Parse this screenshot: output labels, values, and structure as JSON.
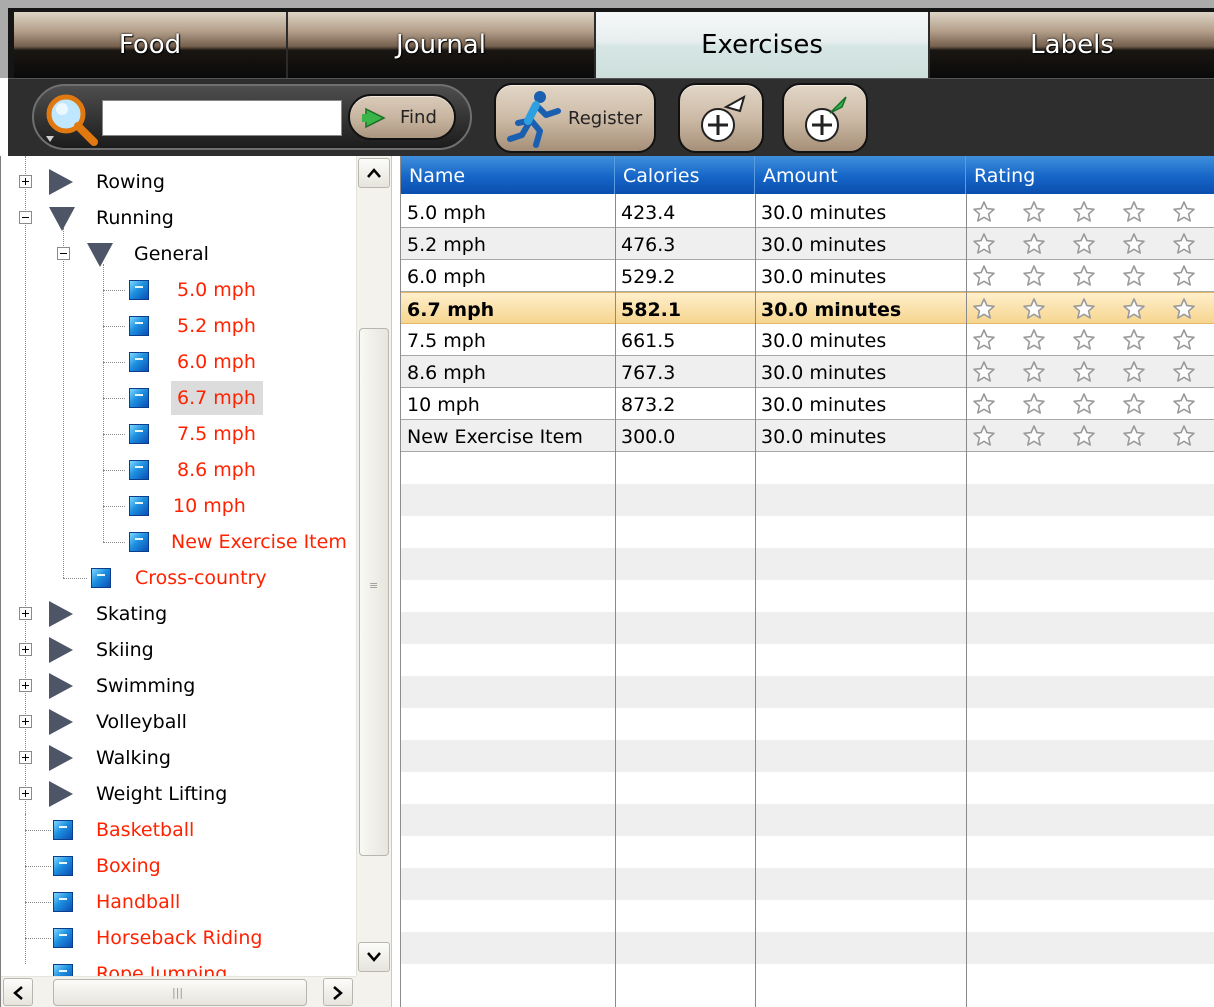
{
  "tabs": [
    {
      "label": "Food",
      "active": false
    },
    {
      "label": "Journal",
      "active": false
    },
    {
      "label": "Exercises",
      "active": true
    },
    {
      "label": "Labels",
      "active": false
    }
  ],
  "toolbar": {
    "search_value": "",
    "find_label": "Find",
    "register_label": "Register"
  },
  "tree": {
    "top_groups": [
      "Rowing",
      "Running"
    ],
    "running_subgroup": "General",
    "general_items": [
      "5.0 mph",
      "5.2 mph",
      "6.0 mph",
      "6.7 mph",
      "7.5 mph",
      "8.6 mph",
      "10 mph",
      "New Exercise Item"
    ],
    "selected_item": "6.7 mph",
    "running_leaf": "Cross-country",
    "more_groups": [
      "Skating",
      "Skiing",
      "Swimming",
      "Volleyball",
      "Walking",
      "Weight Lifting"
    ],
    "root_leaves": [
      "Basketball",
      "Boxing",
      "Handball",
      "Horseback Riding"
    ],
    "partial_leaf": "Rope Jumping"
  },
  "grid": {
    "columns": [
      "Name",
      "Calories",
      "Amount",
      "Rating"
    ],
    "rows": [
      {
        "name": "5.0 mph",
        "calories": "423.4",
        "amount": "30.0 minutes",
        "rating": 0
      },
      {
        "name": "5.2 mph",
        "calories": "476.3",
        "amount": "30.0 minutes",
        "rating": 0
      },
      {
        "name": "6.0 mph",
        "calories": "529.2",
        "amount": "30.0 minutes",
        "rating": 0
      },
      {
        "name": "6.7 mph",
        "calories": "582.1",
        "amount": "30.0 minutes",
        "rating": 0,
        "selected": true
      },
      {
        "name": "7.5 mph",
        "calories": "661.5",
        "amount": "30.0 minutes",
        "rating": 0
      },
      {
        "name": "8.6 mph",
        "calories": "767.3",
        "amount": "30.0 minutes",
        "rating": 0
      },
      {
        "name": "10 mph",
        "calories": "873.2",
        "amount": "30.0 minutes",
        "rating": 0
      },
      {
        "name": "New Exercise Item",
        "calories": "300.0",
        "amount": "30.0 minutes",
        "rating": 0
      }
    ],
    "max_rating": 5
  },
  "colors": {
    "header_blue": "#1565c8",
    "leaf_text_red": "#ff2200",
    "selected_row": "#f6d58f"
  }
}
